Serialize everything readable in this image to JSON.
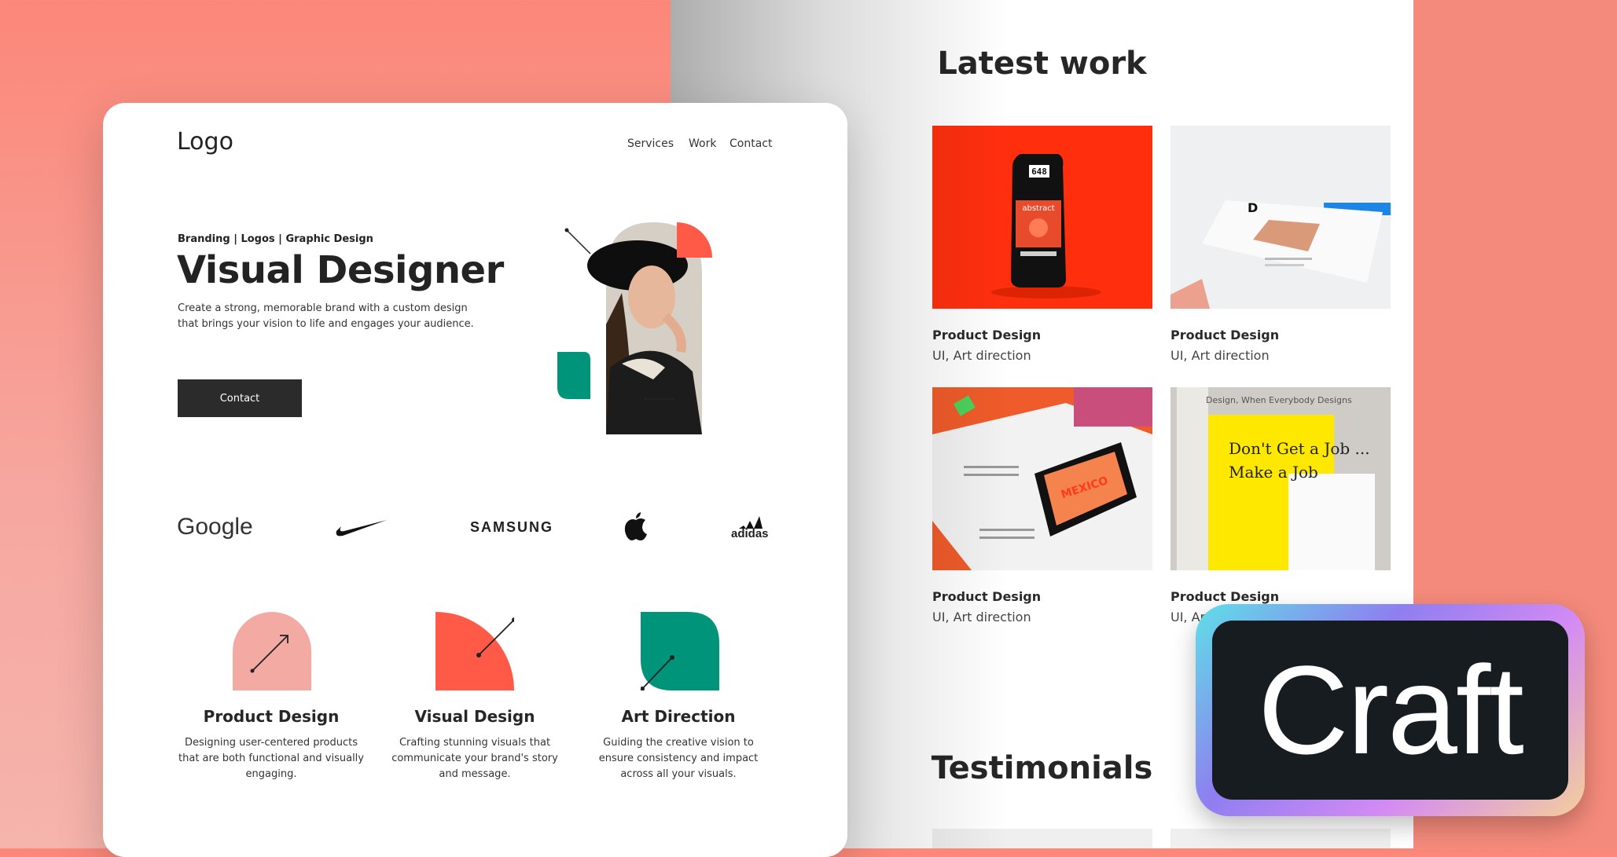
{
  "colors": {
    "background_coral": "#f8867a",
    "accent_red": "#ff5a47",
    "accent_pink": "#f3aaa2",
    "accent_green": "#00947a",
    "button_dark": "#2b2b2b",
    "craft_badge_bg": "#171c21"
  },
  "latest_work": {
    "title": "Latest work",
    "items": [
      {
        "name": "Product Design",
        "tags": "UI, Art direction"
      },
      {
        "name": "Product Design",
        "tags": "UI, Art direction"
      },
      {
        "name": "Product Design",
        "tags": "UI, Art direction"
      },
      {
        "name": "Product Design",
        "tags": "UI, Art"
      }
    ],
    "thumb_texts": {
      "pouch_top": "648",
      "pouch_label": "abstract",
      "card_letter": "D",
      "book_header": "Design, When Everybody Designs",
      "book_yellow_1": "Don't Get a Job ...",
      "book_yellow_2": "Make a Job",
      "magazine_text": "MEXICO"
    },
    "testimonials_title": "Testimonials"
  },
  "front": {
    "logo": "Logo",
    "nav": [
      "Services",
      "Work",
      "Contact"
    ],
    "hero": {
      "eyebrow": "Branding | Logos | Graphic Design",
      "title": "Visual Designer",
      "description": "Create a strong, memorable brand with a custom design that brings your vision to life and engages your audience.",
      "button": "Contact"
    },
    "brands": [
      "Google",
      "Nike",
      "SAMSUNG",
      "Apple",
      "adidas"
    ],
    "brand_labels": {
      "google": "Google",
      "samsung": "SAMSUNG",
      "adidas": "adidas"
    },
    "services": [
      {
        "title": "Product Design",
        "description": "Designing user-centered products that are both functional and visually engaging.",
        "icon": "pink-arch-arrow-icon"
      },
      {
        "title": "Visual Design",
        "description": "Crafting stunning visuals that communicate your brand's story and message.",
        "icon": "red-quarter-circle-icon"
      },
      {
        "title": "Art Direction",
        "description": "Guiding the creative vision to ensure consistency and impact across all your visuals.",
        "icon": "green-leaf-icon"
      }
    ]
  },
  "badge": {
    "text": "Craft"
  }
}
